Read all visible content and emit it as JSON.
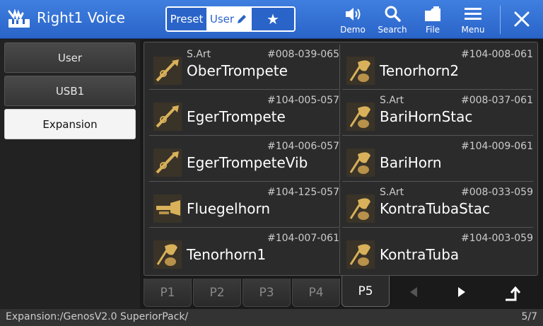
{
  "header": {
    "title": "Right1 Voice",
    "title_icon": "keyboard-hand-icon",
    "segments": {
      "preset": "Preset",
      "user": "User",
      "favorite": "★"
    },
    "buttons": {
      "demo": "Demo",
      "search": "Search",
      "file": "File",
      "menu": "Menu"
    }
  },
  "sidebar": {
    "items": [
      {
        "label": "User",
        "active": false
      },
      {
        "label": "USB1",
        "active": false
      },
      {
        "label": "Expansion",
        "active": true
      }
    ]
  },
  "voices": [
    {
      "tag": "S.Art",
      "number": "#008-039-065",
      "name": "OberTrompete",
      "icon": "trumpet-icon"
    },
    {
      "tag": "",
      "number": "#104-008-061",
      "name": "Tenorhorn2",
      "icon": "horn-icon"
    },
    {
      "tag": "",
      "number": "#104-005-057",
      "name": "EgerTrompete",
      "icon": "trumpet-icon"
    },
    {
      "tag": "S.Art",
      "number": "#008-037-061",
      "name": "BariHornStac",
      "icon": "horn-icon"
    },
    {
      "tag": "",
      "number": "#104-006-057",
      "name": "EgerTrompeteVib",
      "icon": "trumpet-icon"
    },
    {
      "tag": "",
      "number": "#104-009-061",
      "name": "BariHorn",
      "icon": "horn-icon"
    },
    {
      "tag": "",
      "number": "#104-125-057",
      "name": "Fluegelhorn",
      "icon": "flugelhorn-icon"
    },
    {
      "tag": "S.Art",
      "number": "#008-033-059",
      "name": "KontraTubaStac",
      "icon": "horn-icon"
    },
    {
      "tag": "",
      "number": "#104-007-061",
      "name": "Tenorhorn1",
      "icon": "horn-icon"
    },
    {
      "tag": "",
      "number": "#104-003-059",
      "name": "KontraTuba",
      "icon": "horn-icon"
    }
  ],
  "pager": {
    "tabs": [
      "P1",
      "P2",
      "P3",
      "P4",
      "P5"
    ],
    "active_tab": "P5"
  },
  "status": {
    "path": "Expansion:/GenosV2.0 SuperiorPack/",
    "page": "5/7"
  },
  "colors": {
    "header_blue": "#2a64c8",
    "instrument_gold": "#d8b15a"
  }
}
